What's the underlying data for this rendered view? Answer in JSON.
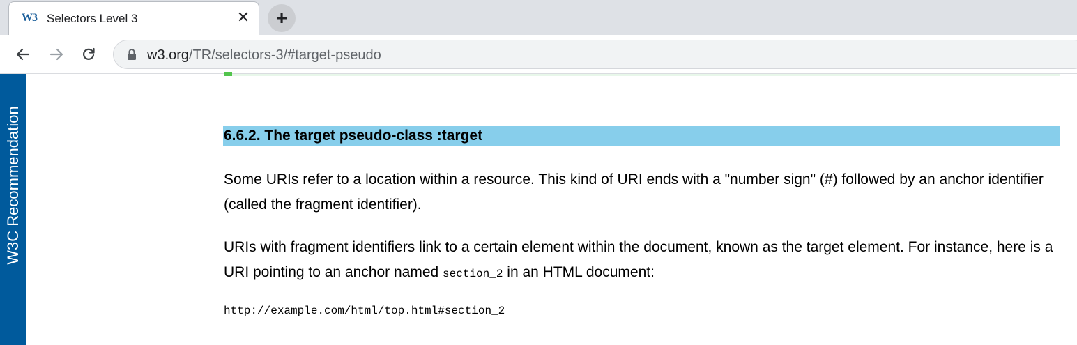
{
  "browser": {
    "tab": {
      "favicon_text": "W3",
      "title": "Selectors Level 3",
      "close_glyph": "✕"
    },
    "new_tab_glyph": "+",
    "address_bar": {
      "host": "w3.org",
      "path": "/TR/selectors-3/#target-pseudo"
    },
    "icons": [
      "back-arrow-icon",
      "forward-arrow-icon",
      "reload-icon",
      "lock-icon"
    ]
  },
  "sidebar": {
    "label": "W3C Recommendation",
    "color": "#005a9c"
  },
  "section": {
    "heading": "6.6.2. The target pseudo-class :target",
    "heading_bg": "#87ceeb",
    "paragraph1": "Some URIs refer to a location within a resource. This kind of URI ends with a \"number sign\" (#) followed by an anchor identifier (called the fragment identifier).",
    "paragraph2_before": "URIs with fragment identifiers link to a certain element within the document, known as the target element. For instance, here is a URI pointing to an anchor named ",
    "paragraph2_code": "section_2",
    "paragraph2_after": " in an HTML document:",
    "example_code": "http://example.com/html/top.html#section_2"
  }
}
